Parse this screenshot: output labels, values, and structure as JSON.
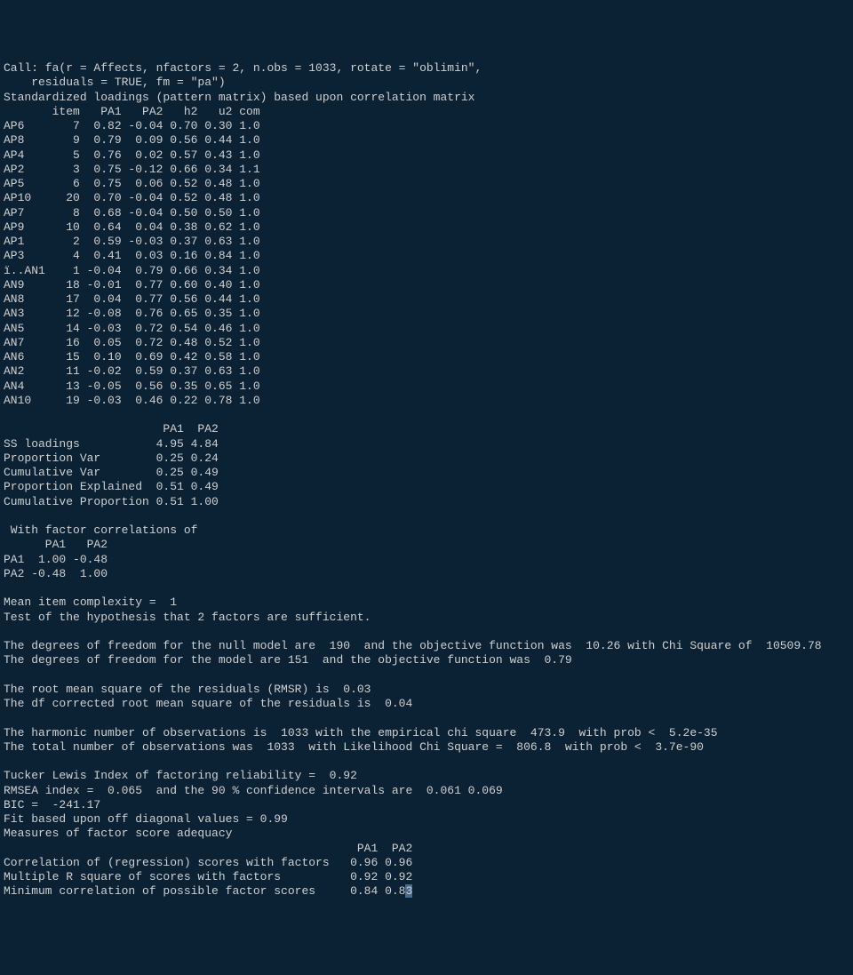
{
  "call": {
    "line1": "Call: fa(r = Affects, nfactors = 2, n.obs = 1033, rotate = \"oblimin\", ",
    "line2": "    residuals = TRUE, fm = \"pa\")"
  },
  "loadings_header": "Standardized loadings (pattern matrix) based upon correlation matrix",
  "loadings_cols": "       item   PA1   PA2   h2   u2 com",
  "loadings": [
    {
      "name": "AP6",
      "item": 7,
      "PA1": "0.82",
      "PA2": "-0.04",
      "h2": "0.70",
      "u2": "0.30",
      "com": "1.0"
    },
    {
      "name": "AP8",
      "item": 9,
      "PA1": "0.79",
      "PA2": "0.09",
      "h2": "0.56",
      "u2": "0.44",
      "com": "1.0"
    },
    {
      "name": "AP4",
      "item": 5,
      "PA1": "0.76",
      "PA2": "0.02",
      "h2": "0.57",
      "u2": "0.43",
      "com": "1.0"
    },
    {
      "name": "AP2",
      "item": 3,
      "PA1": "0.75",
      "PA2": "-0.12",
      "h2": "0.66",
      "u2": "0.34",
      "com": "1.1"
    },
    {
      "name": "AP5",
      "item": 6,
      "PA1": "0.75",
      "PA2": "0.06",
      "h2": "0.52",
      "u2": "0.48",
      "com": "1.0"
    },
    {
      "name": "AP10",
      "item": 20,
      "PA1": "0.70",
      "PA2": "-0.04",
      "h2": "0.52",
      "u2": "0.48",
      "com": "1.0"
    },
    {
      "name": "AP7",
      "item": 8,
      "PA1": "0.68",
      "PA2": "-0.04",
      "h2": "0.50",
      "u2": "0.50",
      "com": "1.0"
    },
    {
      "name": "AP9",
      "item": 10,
      "PA1": "0.64",
      "PA2": "0.04",
      "h2": "0.38",
      "u2": "0.62",
      "com": "1.0"
    },
    {
      "name": "AP1",
      "item": 2,
      "PA1": "0.59",
      "PA2": "-0.03",
      "h2": "0.37",
      "u2": "0.63",
      "com": "1.0"
    },
    {
      "name": "AP3",
      "item": 4,
      "PA1": "0.41",
      "PA2": "0.03",
      "h2": "0.16",
      "u2": "0.84",
      "com": "1.0"
    },
    {
      "name": "ï..AN1",
      "item": 1,
      "PA1": "-0.04",
      "PA2": "0.79",
      "h2": "0.66",
      "u2": "0.34",
      "com": "1.0"
    },
    {
      "name": "AN9",
      "item": 18,
      "PA1": "-0.01",
      "PA2": "0.77",
      "h2": "0.60",
      "u2": "0.40",
      "com": "1.0"
    },
    {
      "name": "AN8",
      "item": 17,
      "PA1": "0.04",
      "PA2": "0.77",
      "h2": "0.56",
      "u2": "0.44",
      "com": "1.0"
    },
    {
      "name": "AN3",
      "item": 12,
      "PA1": "-0.08",
      "PA2": "0.76",
      "h2": "0.65",
      "u2": "0.35",
      "com": "1.0"
    },
    {
      "name": "AN5",
      "item": 14,
      "PA1": "-0.03",
      "PA2": "0.72",
      "h2": "0.54",
      "u2": "0.46",
      "com": "1.0"
    },
    {
      "name": "AN7",
      "item": 16,
      "PA1": "0.05",
      "PA2": "0.72",
      "h2": "0.48",
      "u2": "0.52",
      "com": "1.0"
    },
    {
      "name": "AN6",
      "item": 15,
      "PA1": "0.10",
      "PA2": "0.69",
      "h2": "0.42",
      "u2": "0.58",
      "com": "1.0"
    },
    {
      "name": "AN2",
      "item": 11,
      "PA1": "-0.02",
      "PA2": "0.59",
      "h2": "0.37",
      "u2": "0.63",
      "com": "1.0"
    },
    {
      "name": "AN4",
      "item": 13,
      "PA1": "-0.05",
      "PA2": "0.56",
      "h2": "0.35",
      "u2": "0.65",
      "com": "1.0"
    },
    {
      "name": "AN10",
      "item": 19,
      "PA1": "-0.03",
      "PA2": "0.46",
      "h2": "0.22",
      "u2": "0.78",
      "com": "1.0"
    }
  ],
  "var_header": "                       PA1  PA2",
  "var_rows": [
    {
      "label": "SS loadings          ",
      "PA1": "4.95",
      "PA2": "4.84"
    },
    {
      "label": "Proportion Var       ",
      "PA1": "0.25",
      "PA2": "0.24"
    },
    {
      "label": "Cumulative Var       ",
      "PA1": "0.25",
      "PA2": "0.49"
    },
    {
      "label": "Proportion Explained ",
      "PA1": "0.51",
      "PA2": "0.49"
    },
    {
      "label": "Cumulative Proportion",
      "PA1": "0.51",
      "PA2": "1.00"
    }
  ],
  "corr_header": " With factor correlations of ",
  "corr_cols": "      PA1   PA2",
  "corr_rows": [
    {
      "label": "PA1",
      "c1": " 1.00",
      "c2": "-0.48"
    },
    {
      "label": "PA2",
      "c1": "-0.48",
      "c2": " 1.00"
    }
  ],
  "stats": {
    "complexity": "Mean item complexity =  1",
    "hypothesis": "Test of the hypothesis that 2 factors are sufficient.",
    "df_null": "The degrees of freedom for the null model are  190  and the objective function was  10.26 with Chi Square of  10509.78",
    "df_model": "The degrees of freedom for the model are 151  and the objective function was  0.79 ",
    "rmsr": "The root mean square of the residuals (RMSR) is  0.03 ",
    "df_corrected": "The df corrected root mean square of the residuals is  0.04 ",
    "harmonic": "The harmonic number of observations is  1033 with the empirical chi square  473.9  with prob <  5.2e-35 ",
    "total_obs": "The total number of observations was  1033  with Likelihood Chi Square =  806.8  with prob <  3.7e-90 ",
    "tucker": "Tucker Lewis Index of factoring reliability =  0.92",
    "rmsea": "RMSEA index =  0.065  and the 90 % confidence intervals are  0.061 0.069",
    "bic": "BIC =  -241.17",
    "fit": "Fit based upon off diagonal values = 0.99",
    "measures": "Measures of factor score adequacy             "
  },
  "adequacy_header": "                                                   PA1  PA2",
  "adequacy_rows": [
    {
      "label": "Correlation of (regression) scores with factors  ",
      "PA1": "0.96",
      "PA2": "0.96"
    },
    {
      "label": "Multiple R square of scores with factors         ",
      "PA1": "0.92",
      "PA2": "0.92"
    },
    {
      "label": "Minimum correlation of possible factor scores    ",
      "PA1": "0.84",
      "PA2_a": "0.8",
      "PA2_b": "3"
    }
  ]
}
